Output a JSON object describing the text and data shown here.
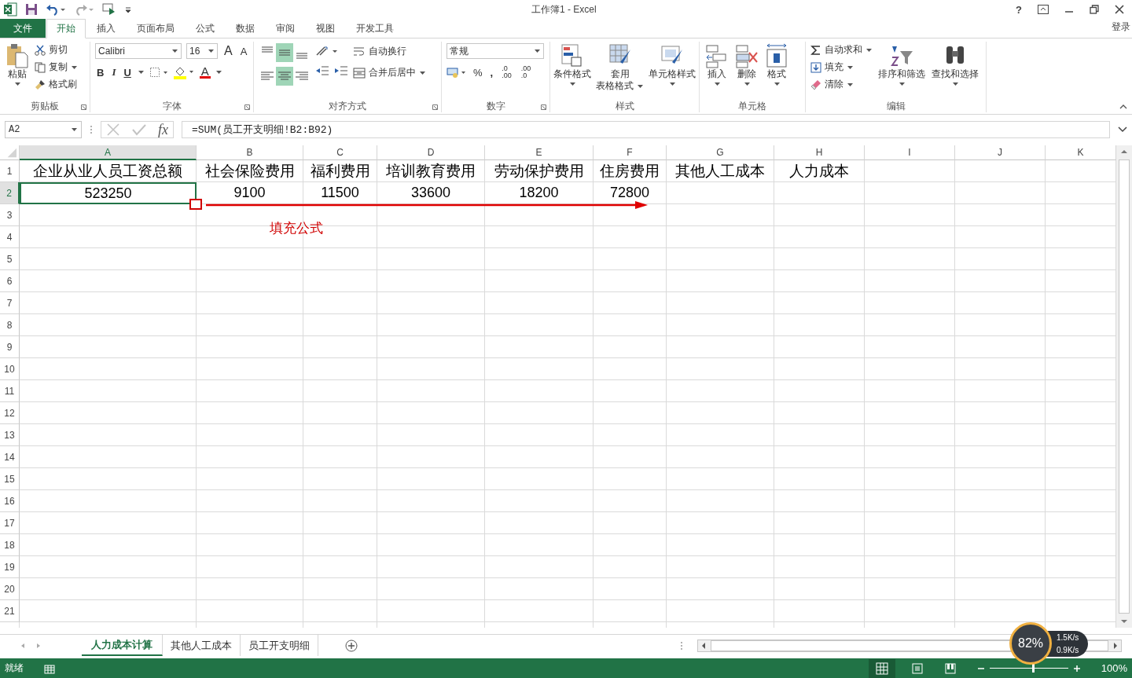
{
  "title_bar": {
    "title": "工作簿1 - Excel",
    "help": "?",
    "sign_in": "登录"
  },
  "menu_tabs": [
    {
      "label": "文件",
      "kind": "file",
      "selected": false
    },
    {
      "label": "开始",
      "kind": "tab",
      "selected": true
    },
    {
      "label": "插入",
      "kind": "tab",
      "selected": false
    },
    {
      "label": "页面布局",
      "kind": "tab",
      "selected": false
    },
    {
      "label": "公式",
      "kind": "tab",
      "selected": false
    },
    {
      "label": "数据",
      "kind": "tab",
      "selected": false
    },
    {
      "label": "审阅",
      "kind": "tab",
      "selected": false
    },
    {
      "label": "视图",
      "kind": "tab",
      "selected": false
    },
    {
      "label": "开发工具",
      "kind": "tab",
      "selected": false
    }
  ],
  "ribbon": {
    "clipboard": {
      "label": "剪贴板",
      "paste": "粘贴",
      "cut": "剪切",
      "copy": "复制",
      "format_painter": "格式刷"
    },
    "font": {
      "label": "字体",
      "font_name": "Calibri",
      "font_size": "16",
      "grow": "A",
      "shrink": "A",
      "bold": "B",
      "italic": "I",
      "underline": "U",
      "font_color": "A"
    },
    "alignment": {
      "label": "对齐方式",
      "wrap_text": "自动换行",
      "merge_center": "合并后居中",
      "align_buttons": [
        {
          "selected": false
        },
        {
          "selected": true
        },
        {
          "selected": false
        },
        {
          "selected": false
        },
        {
          "selected": true
        },
        {
          "selected": false
        }
      ]
    },
    "number": {
      "label": "数字",
      "format": "常规",
      "percent": "%",
      "comma": ",",
      "decimal_buttons": [
        {
          "top": ".0",
          "bottom": ".00"
        },
        {
          "top": ".00",
          "bottom": ".0"
        }
      ]
    },
    "styles": {
      "label": "样式",
      "conditional": "条件格式",
      "table_format": [
        "套用",
        "表格格式"
      ],
      "cell_styles": "单元格样式"
    },
    "cells": {
      "label": "单元格",
      "insert": "插入",
      "delete": "删除",
      "format": "格式"
    },
    "editing": {
      "label": "编辑",
      "autosum": "自动求和",
      "fill": "填充",
      "clear": "清除",
      "sort_filter": "排序和筛选",
      "find_select": "查找和选择"
    }
  },
  "formula_bar": {
    "name_box": "A2",
    "function_label": "fx",
    "formula": "=SUM(员工开支明细!B2:B92)"
  },
  "columns": [
    {
      "label": "A",
      "selected": true
    },
    {
      "label": "B",
      "selected": false
    },
    {
      "label": "C",
      "selected": false
    },
    {
      "label": "D",
      "selected": false
    },
    {
      "label": "E",
      "selected": false
    },
    {
      "label": "F",
      "selected": false
    },
    {
      "label": "G",
      "selected": false
    },
    {
      "label": "H",
      "selected": false
    },
    {
      "label": "I",
      "selected": false
    },
    {
      "label": "J",
      "selected": false
    },
    {
      "label": "K",
      "selected": false
    }
  ],
  "rows": [
    {
      "number": "1",
      "selected": false,
      "cells": [
        "企业从业人员工资总额",
        "社会保险费用",
        "福利费用",
        "培训教育费用",
        "劳动保护费用",
        "住房费用",
        "其他人工成本",
        "人力成本"
      ]
    },
    {
      "number": "2",
      "selected": true,
      "cells": [
        "523250",
        "9100",
        "11500",
        "33600",
        "18200",
        "72800"
      ]
    },
    {
      "number": "3",
      "selected": false
    },
    {
      "number": "4",
      "selected": false
    },
    {
      "number": "5",
      "selected": false
    },
    {
      "number": "6",
      "selected": false
    },
    {
      "number": "7",
      "selected": false
    },
    {
      "number": "8",
      "selected": false
    },
    {
      "number": "9",
      "selected": false
    },
    {
      "number": "10",
      "selected": false
    },
    {
      "number": "11",
      "selected": false
    },
    {
      "number": "12",
      "selected": false
    },
    {
      "number": "13",
      "selected": false
    },
    {
      "number": "14",
      "selected": false
    },
    {
      "number": "15",
      "selected": false
    },
    {
      "number": "16",
      "selected": false
    },
    {
      "number": "17",
      "selected": false
    },
    {
      "number": "18",
      "selected": false
    },
    {
      "number": "19",
      "selected": false
    },
    {
      "number": "20",
      "selected": false
    },
    {
      "number": "21",
      "selected": false
    }
  ],
  "annotation": {
    "text": "填充公式"
  },
  "sheet_tabs": [
    {
      "label": "人力成本计算",
      "selected": true
    },
    {
      "label": "其他人工成本",
      "selected": false
    },
    {
      "label": "员工开支明细",
      "selected": false
    }
  ],
  "status_bar": {
    "status": "就绪",
    "zoom": "100%",
    "zoom_slider": {
      "level": 0.55
    }
  },
  "network_widget": {
    "percent": "82%",
    "upload": "1.5K/s",
    "download": "0.9K/s"
  }
}
